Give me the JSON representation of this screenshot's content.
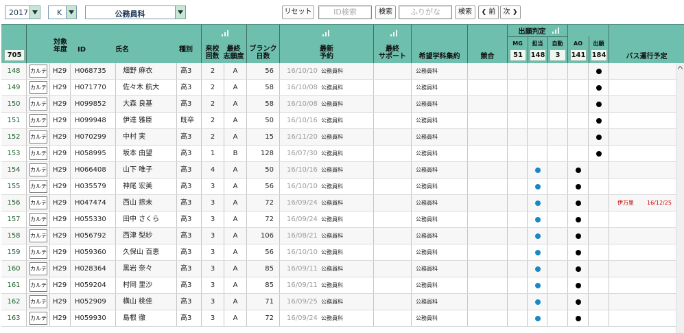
{
  "toolbar": {
    "year": "2017",
    "class": "K",
    "dept": "公務員科",
    "reset_label": "リセット",
    "id_search_placeholder": "ID検索",
    "search_label": "検索",
    "furigana_placeholder": "ふりがな",
    "search2_label": "検索",
    "prev_label": "前",
    "next_label": "次"
  },
  "header": {
    "total_count": "705",
    "target_year_l1": "対象",
    "target_year_l2": "年度",
    "id": "ID",
    "name": "氏名",
    "kind": "種別",
    "visits_l1": "来校",
    "visits_l2": "回数",
    "aspiration_l1": "最終",
    "aspiration_l2": "志願度",
    "blank_l1": "ブランク",
    "blank_l2": "日数",
    "latest_l1": "最新",
    "latest_l2": "予約",
    "support_l1": "最終",
    "support_l2": "サポート",
    "hope": "希望学科集約",
    "compete": "競合",
    "judge": "出願判定",
    "mg": "MG",
    "mg_count": "51",
    "tanto": "担当",
    "tanto_count": "148",
    "auto": "自動",
    "auto_count": "3",
    "ao": "AO",
    "ao_count": "141",
    "apply": "出願",
    "apply_count": "184",
    "bus": "バス運行予定"
  },
  "rows": [
    {
      "no": "148",
      "karte": "カルテ",
      "year": "H29",
      "id": "H068735",
      "name": "畑野 麻衣",
      "kind": "高3",
      "visits": "2",
      "asp": "A",
      "blank": "56",
      "date": "16/10/10",
      "dept": "公務員科",
      "hope": "公務員科",
      "judge": "",
      "apply": "black",
      "bus_place": "",
      "bus_date": ""
    },
    {
      "no": "149",
      "karte": "カルテ",
      "year": "H29",
      "id": "H071770",
      "name": "佐々木 航大",
      "kind": "高3",
      "visits": "2",
      "asp": "A",
      "blank": "58",
      "date": "16/10/08",
      "dept": "公務員科",
      "hope": "公務員科",
      "judge": "",
      "apply": "black",
      "bus_place": "",
      "bus_date": ""
    },
    {
      "no": "150",
      "karte": "カルテ",
      "year": "H29",
      "id": "H099852",
      "name": "大森 良基",
      "kind": "高3",
      "visits": "2",
      "asp": "A",
      "blank": "58",
      "date": "16/10/08",
      "dept": "公務員科",
      "hope": "公務員科",
      "judge": "",
      "apply": "black",
      "bus_place": "",
      "bus_date": ""
    },
    {
      "no": "151",
      "karte": "カルテ",
      "year": "H29",
      "id": "H099948",
      "name": "伊達 雅臣",
      "kind": "既卒",
      "visits": "2",
      "asp": "A",
      "blank": "50",
      "date": "16/10/16",
      "dept": "公務員科",
      "hope": "公務員科",
      "judge": "",
      "apply": "black",
      "bus_place": "",
      "bus_date": ""
    },
    {
      "no": "152",
      "karte": "カルテ",
      "year": "H29",
      "id": "H070299",
      "name": "中村 実",
      "kind": "高3",
      "visits": "2",
      "asp": "A",
      "blank": "15",
      "date": "16/11/20",
      "dept": "公務員科",
      "hope": "公務員科",
      "judge": "",
      "apply": "black",
      "bus_place": "",
      "bus_date": ""
    },
    {
      "no": "153",
      "karte": "カルテ",
      "year": "H29",
      "id": "H058995",
      "name": "坂本 由望",
      "kind": "高3",
      "visits": "1",
      "asp": "B",
      "blank": "128",
      "date": "16/07/30",
      "dept": "公務員科",
      "hope": "公務員科",
      "judge": "",
      "apply": "black",
      "bus_place": "",
      "bus_date": ""
    },
    {
      "no": "154",
      "karte": "カルテ",
      "year": "H29",
      "id": "H066408",
      "name": "山下 唯子",
      "kind": "高3",
      "visits": "4",
      "asp": "A",
      "blank": "50",
      "date": "16/10/16",
      "dept": "公務員科",
      "hope": "公務員科",
      "judge": "blue",
      "apply": "",
      "ao": "black",
      "bus_place": "",
      "bus_date": ""
    },
    {
      "no": "155",
      "karte": "カルテ",
      "year": "H29",
      "id": "H035579",
      "name": "神尾 宏美",
      "kind": "高3",
      "visits": "3",
      "asp": "A",
      "blank": "56",
      "date": "16/10/10",
      "dept": "公務員科",
      "hope": "公務員科",
      "judge": "blue",
      "apply": "",
      "ao": "black",
      "bus_place": "",
      "bus_date": ""
    },
    {
      "no": "156",
      "karte": "カルテ",
      "year": "H29",
      "id": "H047474",
      "name": "西山 捺未",
      "kind": "高3",
      "visits": "3",
      "asp": "A",
      "blank": "72",
      "date": "16/09/24",
      "dept": "公務員科",
      "hope": "公務員科",
      "judge": "blue",
      "apply": "",
      "ao": "black",
      "bus_place": "伊万里",
      "bus_date": "16/12/25"
    },
    {
      "no": "157",
      "karte": "カルテ",
      "year": "H29",
      "id": "H055330",
      "name": "田中 さくら",
      "kind": "高3",
      "visits": "3",
      "asp": "A",
      "blank": "72",
      "date": "16/09/24",
      "dept": "公務員科",
      "hope": "公務員科",
      "judge": "blue",
      "apply": "",
      "ao": "black",
      "bus_place": "",
      "bus_date": ""
    },
    {
      "no": "158",
      "karte": "カルテ",
      "year": "H29",
      "id": "H056792",
      "name": "西津 梨紗",
      "kind": "高3",
      "visits": "3",
      "asp": "A",
      "blank": "106",
      "date": "16/08/21",
      "dept": "公務員科",
      "hope": "公務員科",
      "judge": "blue",
      "apply": "",
      "ao": "black",
      "bus_place": "",
      "bus_date": ""
    },
    {
      "no": "159",
      "karte": "カルテ",
      "year": "H29",
      "id": "H059360",
      "name": "久保山 百恵",
      "kind": "高3",
      "visits": "3",
      "asp": "A",
      "blank": "56",
      "date": "16/10/10",
      "dept": "公務員科",
      "hope": "公務員科",
      "judge": "blue",
      "apply": "",
      "ao": "black",
      "bus_place": "",
      "bus_date": ""
    },
    {
      "no": "160",
      "karte": "カルテ",
      "year": "H29",
      "id": "H028364",
      "name": "黒岩 奈々",
      "kind": "高3",
      "visits": "3",
      "asp": "A",
      "blank": "85",
      "date": "16/09/11",
      "dept": "公務員科",
      "hope": "公務員科",
      "judge": "blue",
      "apply": "",
      "ao": "black",
      "bus_place": "",
      "bus_date": ""
    },
    {
      "no": "161",
      "karte": "カルテ",
      "year": "H29",
      "id": "H059204",
      "name": "村岡 里沙",
      "kind": "高3",
      "visits": "3",
      "asp": "A",
      "blank": "85",
      "date": "16/09/11",
      "dept": "公務員科",
      "hope": "公務員科",
      "judge": "blue",
      "apply": "",
      "ao": "black",
      "bus_place": "",
      "bus_date": ""
    },
    {
      "no": "162",
      "karte": "カルテ",
      "year": "H29",
      "id": "H052909",
      "name": "横山 桃佳",
      "kind": "高3",
      "visits": "3",
      "asp": "A",
      "blank": "71",
      "date": "16/09/25",
      "dept": "公務員科",
      "hope": "公務員科",
      "judge": "blue",
      "apply": "",
      "ao": "black",
      "bus_place": "",
      "bus_date": ""
    },
    {
      "no": "163",
      "karte": "カルテ",
      "year": "H29",
      "id": "H059930",
      "name": "島根 徹",
      "kind": "高3",
      "visits": "3",
      "asp": "A",
      "blank": "72",
      "date": "16/09/24",
      "dept": "公務員科",
      "hope": "公務員科",
      "judge": "blue",
      "apply": "",
      "ao": "black",
      "bus_place": "",
      "bus_date": ""
    }
  ],
  "colors": {
    "header_bg": "#6fbfae",
    "blue_dot": "#1888c8",
    "bus_text": "#cc0000",
    "no_text": "#1f5f2a"
  }
}
